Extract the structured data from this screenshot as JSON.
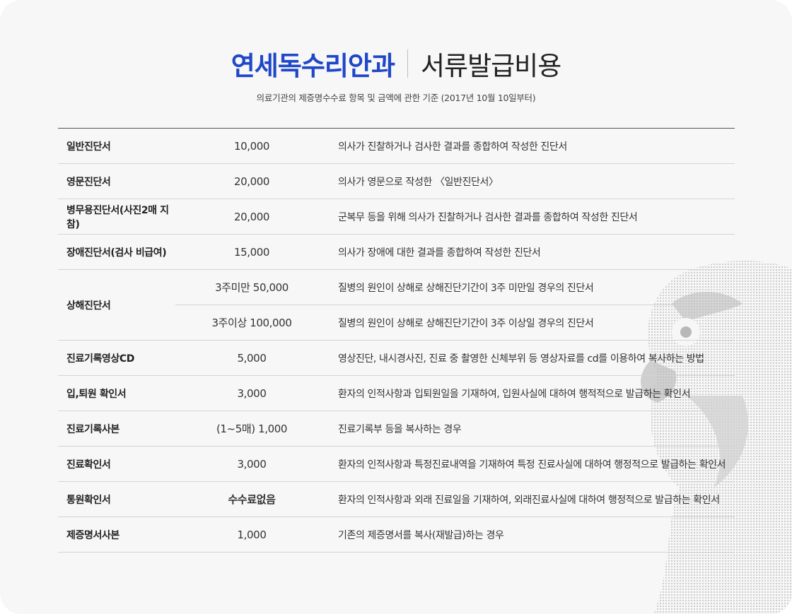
{
  "header": {
    "hospital": "연세독수리안과",
    "document": "서류발급비용",
    "subtitle": "의료기관의 제증명수수료 항목 및 금액에 관한 기준 (2017년 10월 10일부터)"
  },
  "rows": [
    {
      "name": "일반진단서",
      "fee": "10,000",
      "desc": "의사가 진찰하거나 검사한 결과를 종합하여 작성한 진단서"
    },
    {
      "name": "영문진단서",
      "fee": "20,000",
      "desc": "의사가 영문으로 작성한 〈일반진단서〉"
    },
    {
      "name": "병무용진단서(사진2매 지참)",
      "fee": "20,000",
      "desc": "군복무 등을 위해 의사가 진찰하거나 검사한 결과를 종합하여 작성한 진단서"
    },
    {
      "name": "장애진단서(검사 비급여)",
      "fee": "15,000",
      "desc": "의사가 장애에 대한 결과를 종합하여 작성한 진단서"
    },
    {
      "name": "상해진단서",
      "fee": "3주미만 50,000",
      "desc": "질병의 원인이 상해로 상해진단기간이 3주 미만일 경우의 진단서"
    },
    {
      "name": "",
      "fee": "3주이상 100,000",
      "desc": "질병의 원인이 상해로 상해진단기간이 3주 이상일 경우의 진단서"
    },
    {
      "name": "진료기록영상CD",
      "fee": "5,000",
      "desc": "영상진단, 내시경사진, 진료 중 촬영한 신체부위 등 영상자료를 cd를 이용하여 복사하는 방법"
    },
    {
      "name": "입,퇴원 확인서",
      "fee": "3,000",
      "desc": "환자의 인적사항과 입퇴원일을 기재하여, 입원사실에 대하여 행적적으로 발급하는 확인서"
    },
    {
      "name": "진료기록사본",
      "fee": "(1~5매) 1,000",
      "desc": "진료기록부 등을 복사하는 경우"
    },
    {
      "name": "진료확인서",
      "fee": "3,000",
      "desc": "환자의 인적사항과 특정진료내역을 기재하여 특정 진료사실에 대하여 행정적으로 발급하는 확인서"
    },
    {
      "name": "통원확인서",
      "fee": "수수료없음",
      "desc": "환자의 인적사항과 외래 진료일을 기재하여, 외래진료사실에 대하여 행정적으로 발급하는 확인서"
    },
    {
      "name": "제증명서사본",
      "fee": "1,000",
      "desc": "기존의 제증명서를 복사(재발급)하는 경우"
    }
  ],
  "watermark_icon": "eagle-mascot-icon"
}
